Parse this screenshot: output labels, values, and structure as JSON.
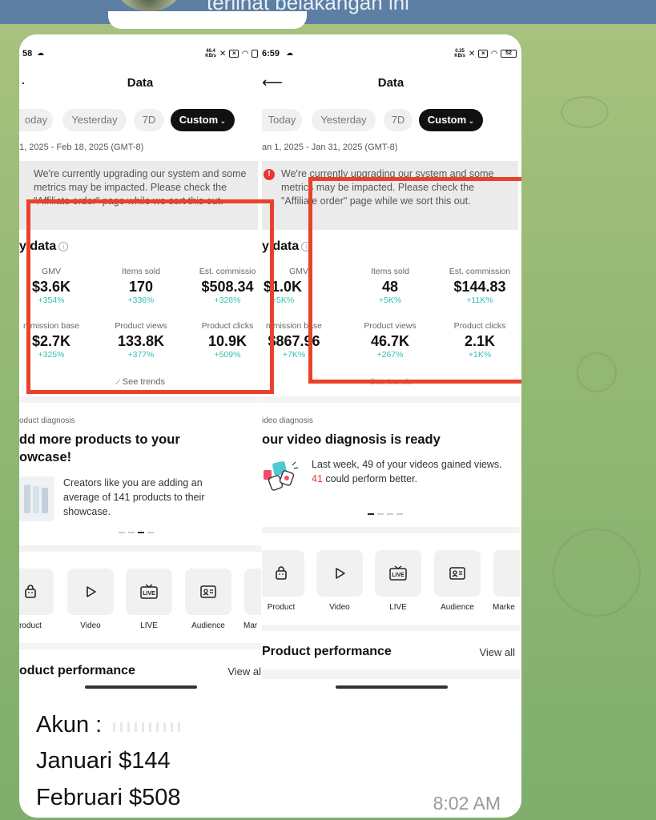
{
  "chat": {
    "header_text": "terlihat belakangan ini",
    "caption_lines": [
      "Akun : ",
      "Januari $144",
      "Februari $508"
    ],
    "time": "8:02 AM"
  },
  "left": {
    "status_time": "58",
    "net_speed": "46.4\nKB/s",
    "title": "Data",
    "tabs": [
      "oday",
      "Yesterday",
      "7D",
      "Custom"
    ],
    "date_range": "1, 2025 - Feb 18, 2025 (GMT-8)",
    "notice": "We're currently upgrading our system and some metrics may be impacted. Please check the \"Affiliate order\" page while we sort this out.",
    "key_data": "y data",
    "metrics": [
      {
        "label": "GMV",
        "value": "$3.6K",
        "change": "+354%"
      },
      {
        "label": "Items sold",
        "value": "170",
        "change": "+336%"
      },
      {
        "label": "Est. commissio",
        "value": "$508.34",
        "change": "+328%"
      },
      {
        "label": "mmission base",
        "value": "$2.7K",
        "change": "+325%"
      },
      {
        "label": "Product views",
        "value": "133.8K",
        "change": "+377%"
      },
      {
        "label": "Product clicks",
        "value": "10.9K",
        "change": "+509%"
      }
    ],
    "see_trends": "See trends",
    "diag_label": "oduct diagnosis",
    "diag_title": "dd more products to your\nowcase!",
    "diag_text": "Creators like you are adding an average of 141 products to their showcase.",
    "shortcuts": [
      "roduct",
      "Video",
      "LIVE",
      "Audience",
      "Mar"
    ],
    "perf_title": "oduct performance",
    "view_all": "View al"
  },
  "right": {
    "status_time": "6:59",
    "net_speed": "0.25\nKB/s",
    "battery": "52",
    "title": "Data",
    "tabs": [
      "Today",
      "Yesterday",
      "7D",
      "Custom"
    ],
    "date_range": "an 1, 2025 - Jan 31, 2025 (GMT-8)",
    "notice": "We're currently upgrading our system and some metrics may be impacted. Please check the \"Affiliate order\" page while we sort this out.",
    "key_data": "y data",
    "metrics": [
      {
        "label": "GMV",
        "value": "$1.0K",
        "change": "+5K%"
      },
      {
        "label": "Items sold",
        "value": "48",
        "change": "+5K%"
      },
      {
        "label": "Est. commission",
        "value": "$144.83",
        "change": "+11K%"
      },
      {
        "label": "mmission base",
        "value": "$867.96",
        "change": "+7K%"
      },
      {
        "label": "Product views",
        "value": "46.7K",
        "change": "+267%"
      },
      {
        "label": "Product clicks",
        "value": "2.1K",
        "change": "+1K%"
      }
    ],
    "see_trends": "See trends",
    "diag_label": "ideo diagnosis",
    "diag_title": "our video diagnosis is ready",
    "diag_text_a": "Last week, ",
    "diag_text_b": "49",
    "diag_text_c": " of your videos gained views. ",
    "diag_text_d": "41",
    "diag_text_e": " could perform better.",
    "shortcuts": [
      "Product",
      "Video",
      "LIVE",
      "Audience",
      "Marke"
    ],
    "perf_title": "Product performance",
    "view_all": "View all"
  },
  "colors": {
    "highlight": "#e8432a",
    "positive": "#31bfb0",
    "telegram_header": "#5c7fa3"
  }
}
